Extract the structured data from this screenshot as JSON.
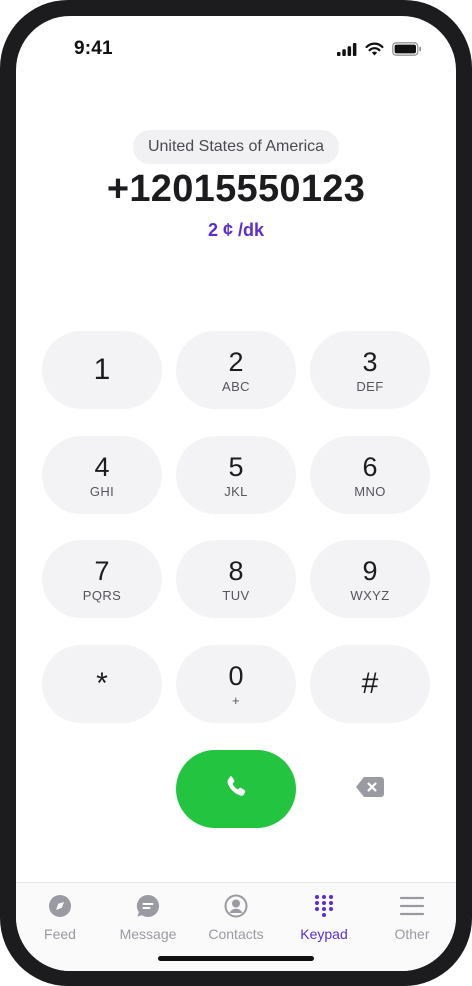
{
  "status_bar": {
    "time": "9:41"
  },
  "dialer": {
    "country": "United States of America",
    "number": "+12015550123",
    "rate": "2 ¢ /dk"
  },
  "keypad": {
    "keys": [
      {
        "digit": "1",
        "letters": ""
      },
      {
        "digit": "2",
        "letters": "ABC"
      },
      {
        "digit": "3",
        "letters": "DEF"
      },
      {
        "digit": "4",
        "letters": "GHI"
      },
      {
        "digit": "5",
        "letters": "JKL"
      },
      {
        "digit": "6",
        "letters": "MNO"
      },
      {
        "digit": "7",
        "letters": "PQRS"
      },
      {
        "digit": "8",
        "letters": "TUV"
      },
      {
        "digit": "9",
        "letters": "WXYZ"
      },
      {
        "digit": "*",
        "letters": ""
      },
      {
        "digit": "0",
        "letters": "+"
      },
      {
        "digit": "#",
        "letters": ""
      }
    ],
    "call_icon": "phone-icon",
    "delete_icon": "backspace-icon"
  },
  "tab_bar": {
    "active_tab": "Keypad",
    "accent_color": "#5a2ed0",
    "tabs": [
      {
        "label": "Feed",
        "icon": "compass-icon"
      },
      {
        "label": "Message",
        "icon": "chat-bubble-icon"
      },
      {
        "label": "Contacts",
        "icon": "person-circle-icon"
      },
      {
        "label": "Keypad",
        "icon": "dialpad-icon"
      },
      {
        "label": "Other",
        "icon": "menu-icon"
      }
    ]
  },
  "colors": {
    "call_button": "#22c440",
    "rate_text": "#5a2ed0",
    "key_background": "#f3f3f5"
  }
}
